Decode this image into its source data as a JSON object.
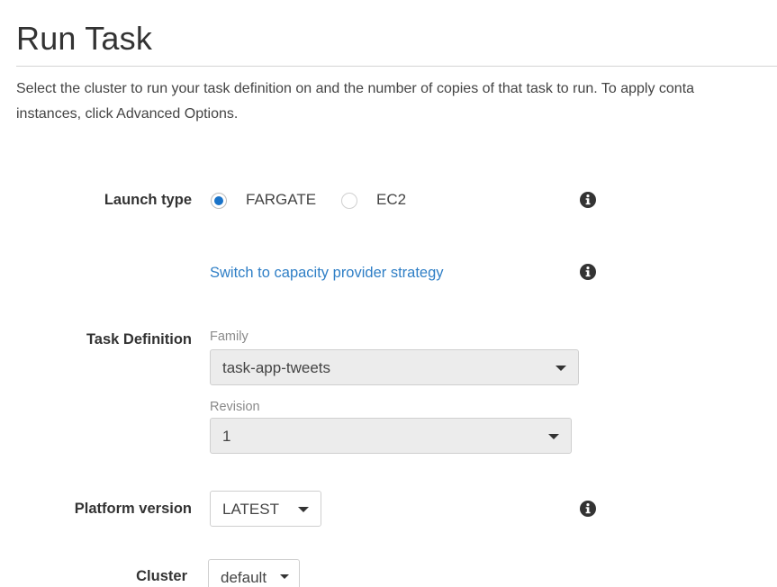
{
  "header": {
    "title": "Run Task",
    "description_line1": "Select the cluster to run your task definition on and the number of copies of that task to run. To apply conta",
    "description_line2": "instances, click Advanced Options."
  },
  "launch_type": {
    "label": "Launch type",
    "options": [
      {
        "label": "FARGATE",
        "selected": true
      },
      {
        "label": "EC2",
        "selected": false
      }
    ],
    "info_icon": "info-icon"
  },
  "capacity_provider": {
    "link_text": "Switch to capacity provider strategy",
    "info_icon": "info-icon"
  },
  "task_definition": {
    "label": "Task Definition",
    "family_label": "Family",
    "family_value": "task-app-tweets",
    "revision_label": "Revision",
    "revision_value": "1"
  },
  "platform_version": {
    "label": "Platform version",
    "value": "LATEST",
    "info_icon": "info-icon"
  },
  "cluster": {
    "label": "Cluster",
    "value": "default"
  },
  "colors": {
    "accent": "#1a73c8",
    "link": "#2f7fc6",
    "select_bg": "#ececec"
  }
}
